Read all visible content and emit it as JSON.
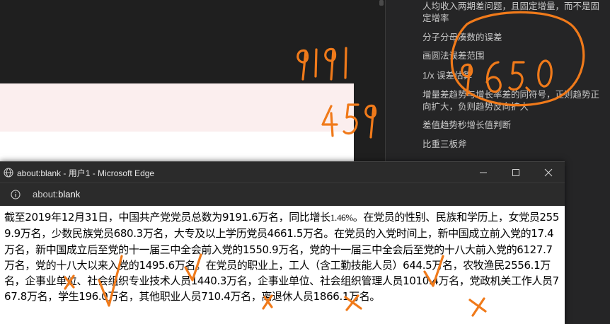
{
  "outline": {
    "items": [
      "人均收入两期差问题，且固定增量，而不是固定增率",
      "分子分母凑数的误差",
      "画圆法误差范围",
      "1/x 误差估算",
      "增量差趋势与增长率差的同符号，正则趋势正向扩大，负则趋势反向扩大",
      "差值趋势秒增长值判断",
      "比重三板斧"
    ]
  },
  "edge": {
    "title": "about:blank - 用户1 - Microsoft Edge",
    "address_prefix": "about:",
    "address_host": "blank"
  },
  "article": {
    "before_pct": "截至2019年12月31日，中国共产党党员总数为9191.6万名，同比增长",
    "pct": "1.46%",
    "after_pct": "。在党员的性别、民族和学历上，女党员2559.9万名，少数民族党员680.3万名，大专及以上学历党员4661.5万名。在党员的入党时间上，新中国成立前入党的17.4万名，新中国成立后至党的十一届三中全会前入党的1550.9万名，党的十一届三中全会后至党的十八大前入党的6127.7万名，党的十八大以来入党的1495.6万名。在党员的职业上，工人（含工勤技能人员）644.5万名，农牧渔民2556.1万名，企事业单位、社会组织专业技术人员1440.3万名，企事业单位、社会组织管理人员1010.4万名，党政机关工作人员767.8万名，学生196.0万名，其他职业人员710.4万名，离退休人员1866.1万名。"
  },
  "annotations": {
    "color": "#f07a1a",
    "numbers": [
      "9191",
      "459",
      "9650"
    ],
    "marks": [
      "x",
      "v",
      "v",
      "x",
      "x",
      "v",
      "x"
    ]
  }
}
